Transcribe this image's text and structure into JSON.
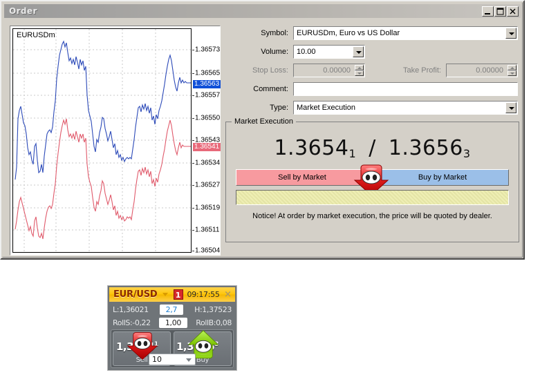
{
  "window": {
    "title": "Order",
    "buttons": {
      "minimize": "minimize-icon",
      "maximize": "maximize-icon",
      "close": "close-icon"
    }
  },
  "chart": {
    "symbol_label": "EURUSDm",
    "y_axis_labels": [
      "1.36573",
      "1.36565",
      "1.36557",
      "1.36550",
      "1.36543",
      "1.36534",
      "1.36527",
      "1.36519",
      "1.36511",
      "1.36504"
    ],
    "bid_tag": "1.36541",
    "ask_tag": "1.36563",
    "bid_color": "#e8697a",
    "ask_color": "#1050d8"
  },
  "form": {
    "symbol": {
      "label": "Symbol:",
      "value": "EURUSDm, Euro vs US Dollar"
    },
    "volume": {
      "label": "Volume:",
      "value": "10.00"
    },
    "stop_loss": {
      "label": "Stop Loss:",
      "value": "0.00000"
    },
    "take_profit": {
      "label": "Take Profit:",
      "value": "0.00000"
    },
    "comment": {
      "label": "Comment:",
      "value": ""
    },
    "type": {
      "label": "Type:",
      "value": "Market Execution"
    }
  },
  "execution": {
    "legend": "Market Execution",
    "price_bid_main": "1.3654",
    "price_bid_pip": "1",
    "price_sep": "/",
    "price_ask_main": "1.3656",
    "price_ask_pip": "3",
    "sell_button": "Sell by Market",
    "buy_button": "Buy by Market",
    "notice": "Notice! At order by market execution, the price will be quoted by dealer.",
    "sell_color": "#f79a9f",
    "buy_color": "#9bbfe8"
  },
  "mini_terminal": {
    "pair": "EUR/USD",
    "badge": "1",
    "time": "09:17:55",
    "close": "×",
    "low_label": "L:1,36021",
    "spread": "2,7",
    "high_label": "H:1,37523",
    "rolls_label": "RollS:-0,22",
    "lots_pill": "1,00",
    "rollb_label": "RollB:0,08",
    "sell_price_main": "1,3654",
    "sell_price_pip": "1",
    "sell_label": "Sell",
    "buy_price_main": "1,3656",
    "buy_price_pip": "8",
    "buy_label": "Buy",
    "lot_value": "10"
  }
}
